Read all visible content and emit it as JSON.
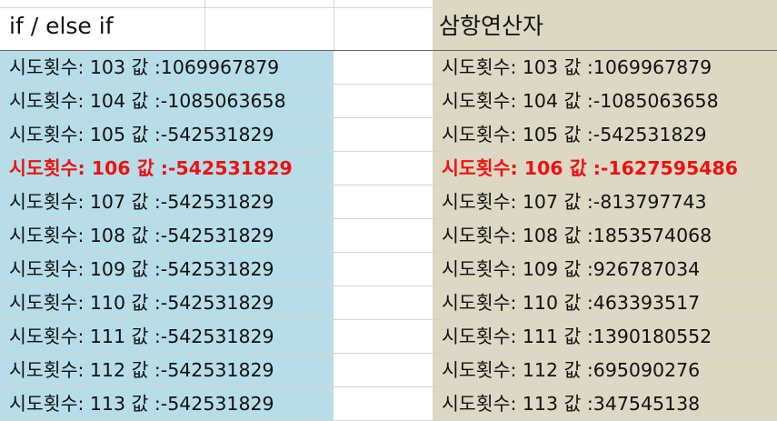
{
  "headers": {
    "left": "if / else if",
    "right": "삼항연산자"
  },
  "colors": {
    "left_column_bg": "#b7dde8",
    "right_column_bg": "#dcd8c4",
    "highlight_text": "#ee1111",
    "gridline": "#d4d4d4"
  },
  "left_rows": [
    {
      "text": "시도횟수: 103 값 :1069967879",
      "highlight": false
    },
    {
      "text": "시도횟수: 104 값 :-1085063658",
      "highlight": false
    },
    {
      "text": "시도횟수: 105 값 :-542531829",
      "highlight": false
    },
    {
      "text": "시도횟수: 106 값 :-542531829",
      "highlight": true
    },
    {
      "text": "시도횟수: 107 값 :-542531829",
      "highlight": false
    },
    {
      "text": "시도횟수: 108 값 :-542531829",
      "highlight": false
    },
    {
      "text": "시도횟수: 109 값 :-542531829",
      "highlight": false
    },
    {
      "text": "시도횟수: 110 값 :-542531829",
      "highlight": false
    },
    {
      "text": "시도횟수: 111 값 :-542531829",
      "highlight": false
    },
    {
      "text": "시도횟수: 112 값 :-542531829",
      "highlight": false
    },
    {
      "text": "시도횟수: 113 값 :-542531829",
      "highlight": false
    }
  ],
  "right_rows": [
    {
      "text": "시도횟수: 103 값 :1069967879",
      "highlight": false
    },
    {
      "text": "시도횟수: 104 값 :-1085063658",
      "highlight": false
    },
    {
      "text": "시도횟수: 105 값 :-542531829",
      "highlight": false
    },
    {
      "text": "시도횟수: 106 값 :-1627595486",
      "highlight": true
    },
    {
      "text": "시도횟수: 107 값 :-813797743",
      "highlight": false
    },
    {
      "text": "시도횟수: 108 값 :1853574068",
      "highlight": false
    },
    {
      "text": "시도횟수: 109 값 :926787034",
      "highlight": false
    },
    {
      "text": "시도횟수: 110 값 :463393517",
      "highlight": false
    },
    {
      "text": "시도횟수: 111 값 :1390180552",
      "highlight": false
    },
    {
      "text": "시도횟수: 112 값 :695090276",
      "highlight": false
    },
    {
      "text": "시도횟수: 113 값 :347545138",
      "highlight": false
    }
  ]
}
